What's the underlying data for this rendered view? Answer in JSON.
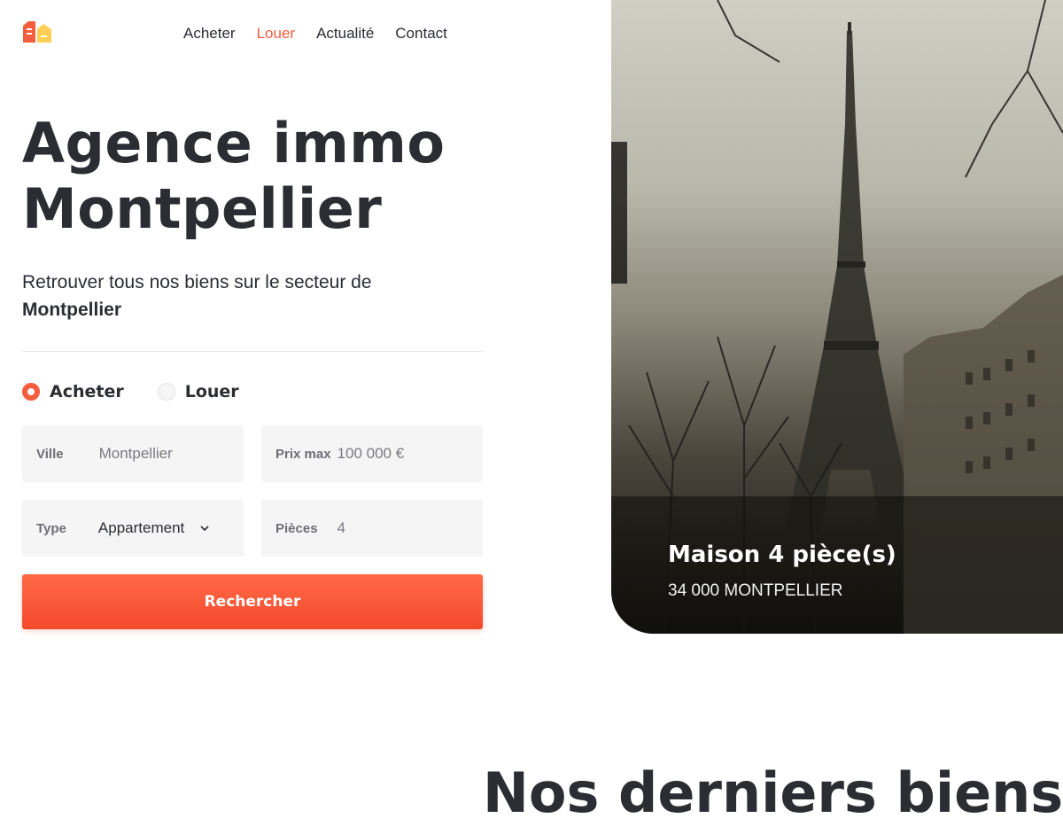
{
  "header": {
    "logo_icon": "house-logo-icon",
    "nav": [
      {
        "label": "Acheter",
        "active": false
      },
      {
        "label": "Louer",
        "active": true
      },
      {
        "label": "Actualité",
        "active": false
      },
      {
        "label": "Contact",
        "active": false
      }
    ]
  },
  "hero": {
    "title_line1": "Agence immo",
    "title_line2": "Montpellier",
    "subtitle": "Retrouver tous nos biens sur le secteur de",
    "subtitle_strong": "Montpellier"
  },
  "search": {
    "mode_options": [
      {
        "label": "Acheter",
        "checked": true
      },
      {
        "label": "Louer",
        "checked": false
      }
    ],
    "ville": {
      "label": "Ville",
      "value": "Montpellier"
    },
    "prix": {
      "label": "Prix max",
      "value": "100 000 €"
    },
    "type": {
      "label": "Type",
      "value": "Appartement"
    },
    "pieces": {
      "label": "Pièces",
      "value": "4"
    },
    "submit_label": "Rechercher"
  },
  "featured": {
    "title": "Maison 4 pièce(s)",
    "location": "34 000 MONTPELLIER"
  },
  "latest": {
    "title": "Nos derniers biens"
  },
  "colors": {
    "accent": "#f45d3e",
    "text": "#2b2d33",
    "field_bg": "#f5f5f6"
  }
}
